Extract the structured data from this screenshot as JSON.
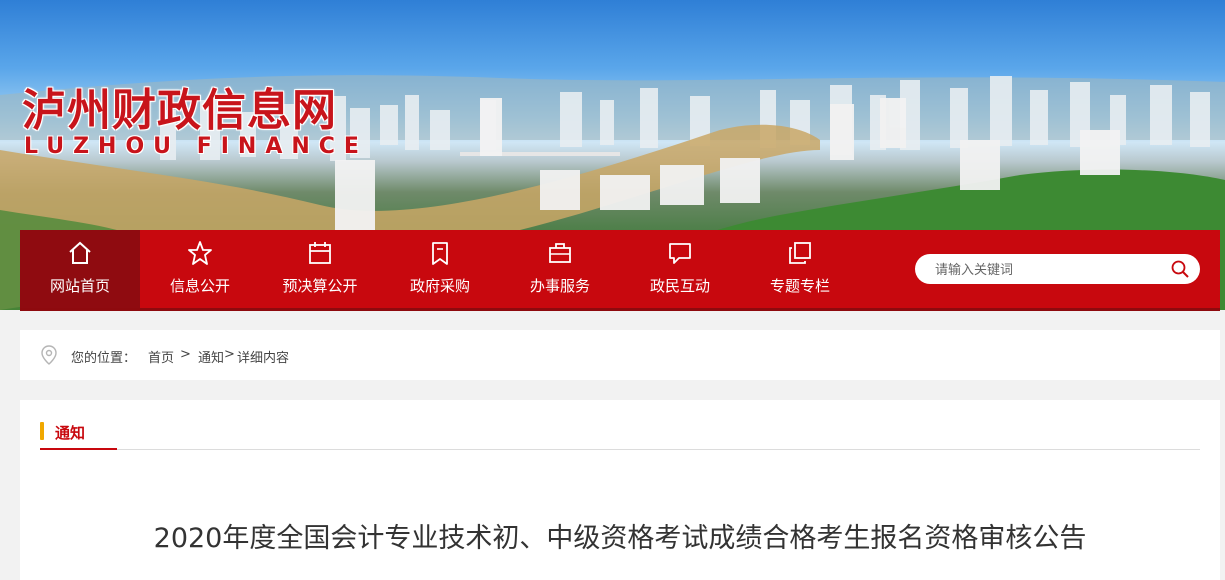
{
  "site": {
    "name_cn": "泸州财政信息网",
    "name_en": "LUZHOU FINANCE"
  },
  "nav": {
    "items": [
      {
        "label": "网站首页",
        "icon": "home-icon",
        "active": true
      },
      {
        "label": "信息公开",
        "icon": "star-icon",
        "active": false
      },
      {
        "label": "预决算公开",
        "icon": "calendar-icon",
        "active": false
      },
      {
        "label": "政府采购",
        "icon": "bookmark-icon",
        "active": false
      },
      {
        "label": "办事服务",
        "icon": "briefcase-icon",
        "active": false
      },
      {
        "label": "政民互动",
        "icon": "chat-icon",
        "active": false
      },
      {
        "label": "专题专栏",
        "icon": "copy-icon",
        "active": false
      }
    ]
  },
  "search": {
    "placeholder": "请输入关键词",
    "value": ""
  },
  "breadcrumb": {
    "prefix": "您的位置：",
    "home": "首页",
    "sep1": " > ",
    "level1": "通知",
    "sep2": " >",
    "current": "详细内容"
  },
  "section": {
    "title": "通知"
  },
  "article": {
    "title": "2020年度全国会计专业技术初、中级资格考试成绩合格考生报名资格审核公告"
  },
  "colors": {
    "brand_red": "#c8080e",
    "nav_active": "#8f0b10",
    "accent_yellow": "#f0a800"
  }
}
